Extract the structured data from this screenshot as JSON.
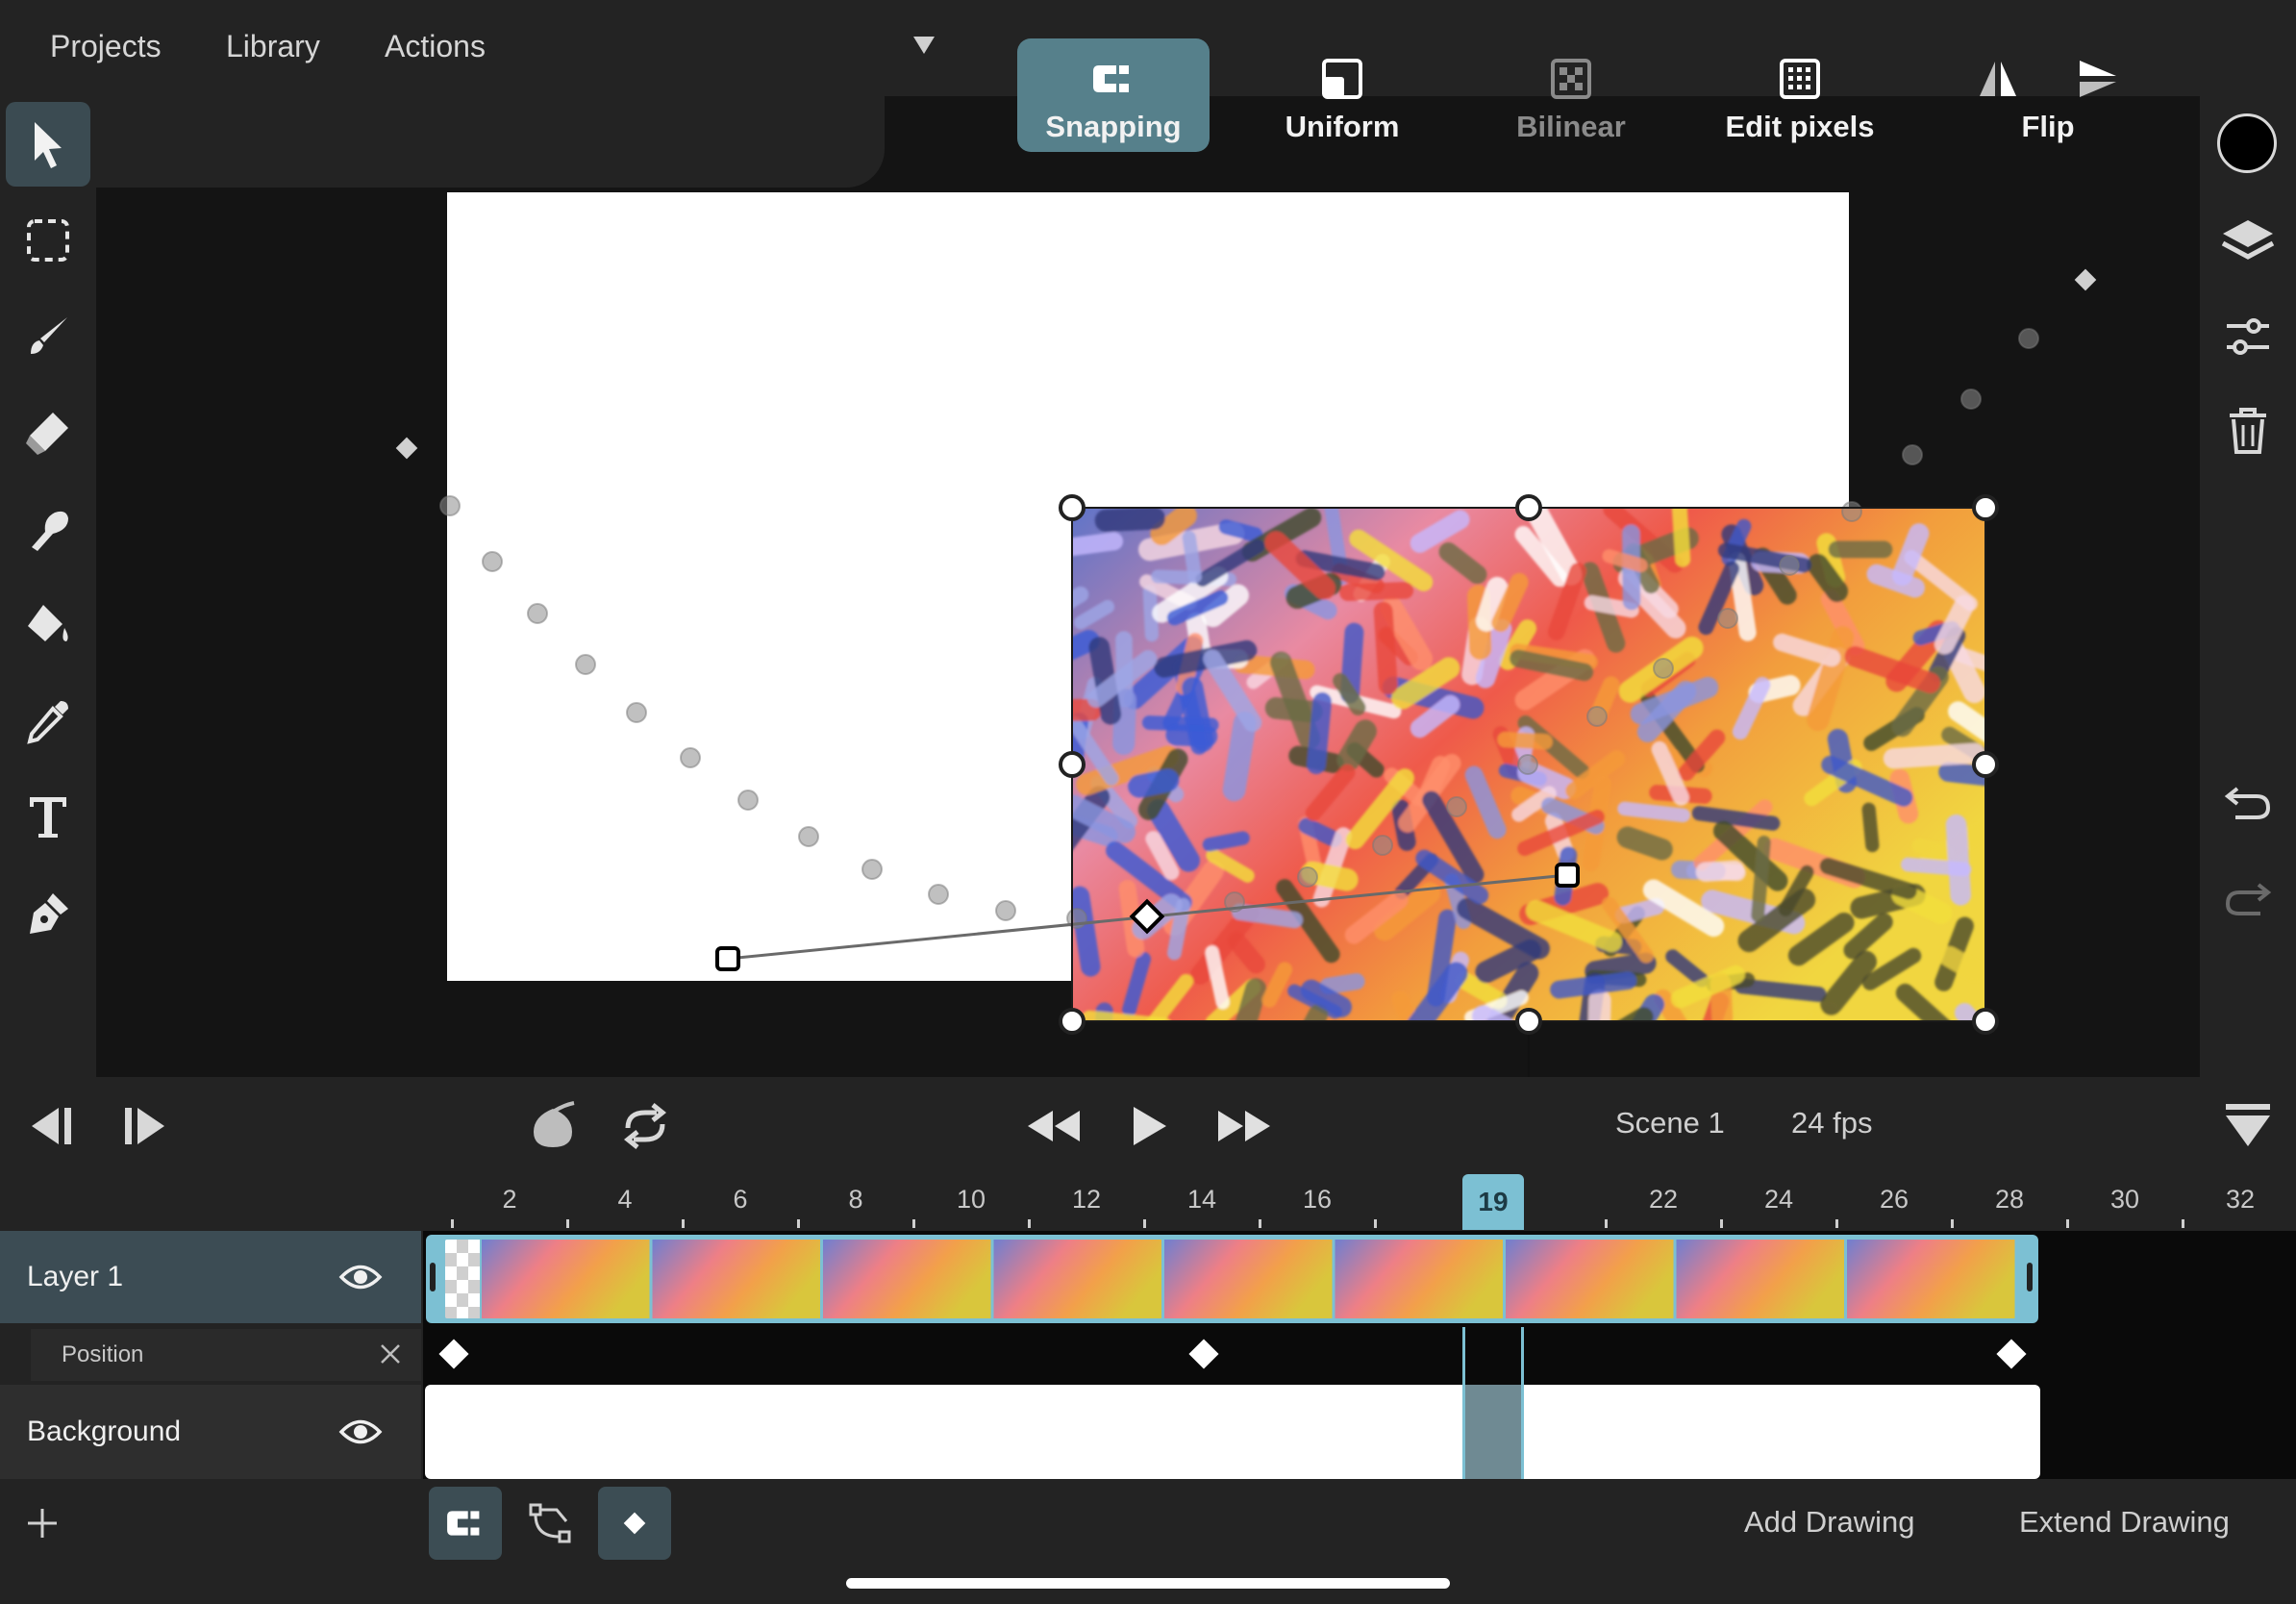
{
  "menu": {
    "projects": "Projects",
    "library": "Library",
    "actions": "Actions"
  },
  "toolbar": {
    "snapping": "Snapping",
    "uniform": "Uniform",
    "bilinear": "Bilinear",
    "edit_pixels": "Edit pixels",
    "flip": "Flip"
  },
  "colors": {
    "accent": "#56808b",
    "playhead": "#7cc0d3",
    "current_color": "#000000"
  },
  "transport": {
    "scene": "Scene 1",
    "fps": "24 fps"
  },
  "timeline": {
    "current_frame": "19",
    "ruler": [
      "2",
      "4",
      "6",
      "8",
      "10",
      "12",
      "14",
      "16",
      "22",
      "24",
      "26",
      "28",
      "30",
      "32"
    ],
    "layers": [
      {
        "name": "Layer 1"
      },
      {
        "name": "Background"
      }
    ],
    "property": "Position"
  },
  "bottom": {
    "add_drawing": "Add Drawing",
    "extend_drawing": "Extend Drawing"
  },
  "icons": [
    "select-arrow-icon",
    "marquee-select-icon",
    "brush-icon",
    "eraser-icon",
    "smudge-icon",
    "fill-bucket-icon",
    "eyedropper-icon",
    "text-icon",
    "pen-icon",
    "layers-icon",
    "adjustments-icon",
    "trash-icon",
    "undo-icon",
    "redo-icon",
    "snapping-magnet-icon",
    "uniform-icon",
    "bilinear-icon",
    "edit-pixels-icon",
    "flip-horizontal-icon",
    "flip-vertical-icon",
    "previous-frame-icon",
    "next-frame-icon",
    "onion-skin-icon",
    "loop-icon",
    "rewind-icon",
    "play-icon",
    "fast-forward-icon",
    "collapse-timeline-icon",
    "eye-icon",
    "close-icon",
    "add-layer-icon",
    "motion-path-icon",
    "keyframe-icon"
  ]
}
